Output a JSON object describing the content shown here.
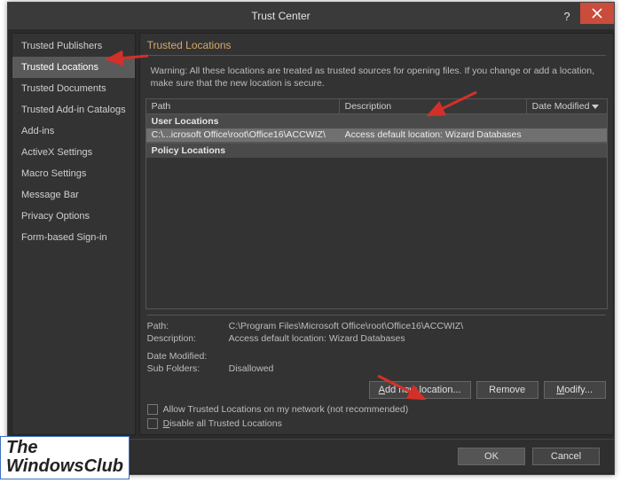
{
  "window": {
    "title": "Trust Center"
  },
  "sidebar": {
    "items": [
      {
        "label": "Trusted Publishers"
      },
      {
        "label": "Trusted Locations"
      },
      {
        "label": "Trusted Documents"
      },
      {
        "label": "Trusted Add-in Catalogs"
      },
      {
        "label": "Add-ins"
      },
      {
        "label": "ActiveX Settings"
      },
      {
        "label": "Macro Settings"
      },
      {
        "label": "Message Bar"
      },
      {
        "label": "Privacy Options"
      },
      {
        "label": "Form-based Sign-in"
      }
    ],
    "selected_index": 1
  },
  "section": {
    "title": "Trusted Locations"
  },
  "warning": "Warning: All these locations are treated as trusted sources for opening files.  If you change or add a location, make sure that the new location is secure.",
  "table": {
    "columns": {
      "path": "Path",
      "description": "Description",
      "date": "Date Modified"
    },
    "groups": {
      "user": "User Locations",
      "policy": "Policy Locations"
    },
    "rows": [
      {
        "path": "C:\\...icrosoft Office\\root\\Office16\\ACCWIZ\\",
        "description": "Access default location: Wizard Databases",
        "date": ""
      }
    ]
  },
  "details": {
    "path_label": "Path:",
    "path_value": "C:\\Program Files\\Microsoft Office\\root\\Office16\\ACCWIZ\\",
    "desc_label": "Description:",
    "desc_value": "Access default location: Wizard Databases",
    "date_label": "Date Modified:",
    "date_value": "",
    "sub_label": "Sub Folders:",
    "sub_value": "Disallowed"
  },
  "actions": {
    "add": "Add new location...",
    "remove": "Remove",
    "modify": "Modify..."
  },
  "checks": {
    "allow_network": "Allow Trusted Locations on my network (not recommended)",
    "disable_all": "Disable all Trusted Locations"
  },
  "footer": {
    "ok": "OK",
    "cancel": "Cancel"
  },
  "watermark": {
    "l1": "The",
    "l2": "WindowsClub"
  }
}
